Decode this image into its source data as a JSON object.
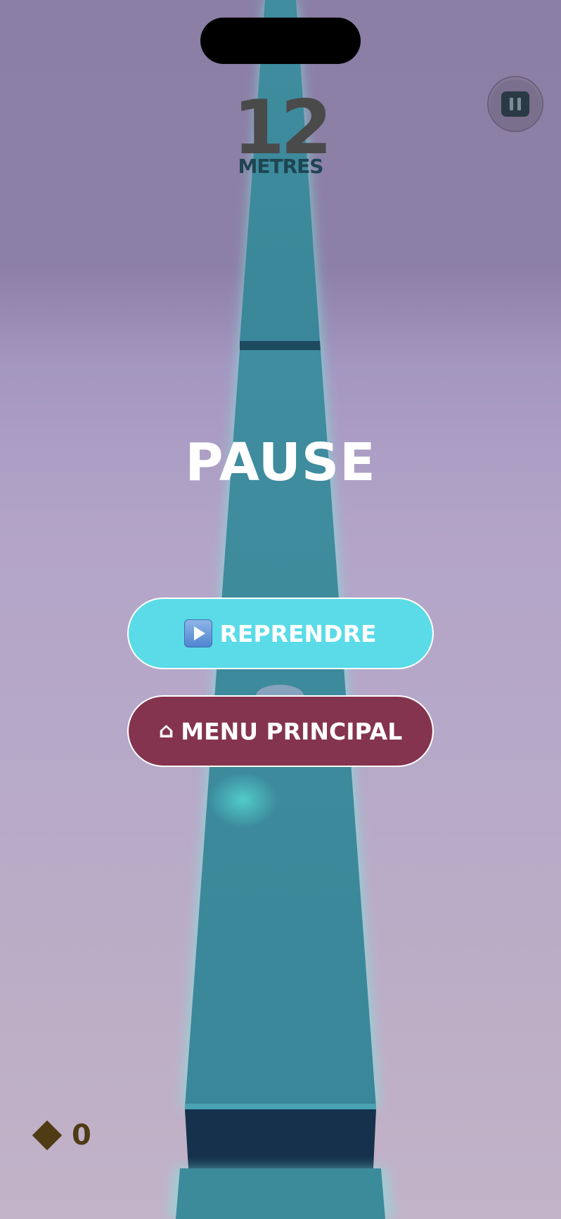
{
  "score": {
    "value": "12",
    "unit": "METRES"
  },
  "pause_menu": {
    "title": "PAUSE",
    "resume_label": "REPRENDRE",
    "menu_label": "MENU PRINCIPAL",
    "resume_icon": "play-icon",
    "menu_icon": "home-icon"
  },
  "hud": {
    "gems": "0",
    "gem_icon": "diamond-icon",
    "pause_icon": "pause-icon"
  },
  "colors": {
    "track": "#3a8a9a",
    "track_edge_glow": "#79e5e0",
    "resume_button": "#5bdbe8",
    "menu_button": "#84344f",
    "sky_top": "#8b7fa5",
    "sky_bottom": "#c2b3c8"
  }
}
